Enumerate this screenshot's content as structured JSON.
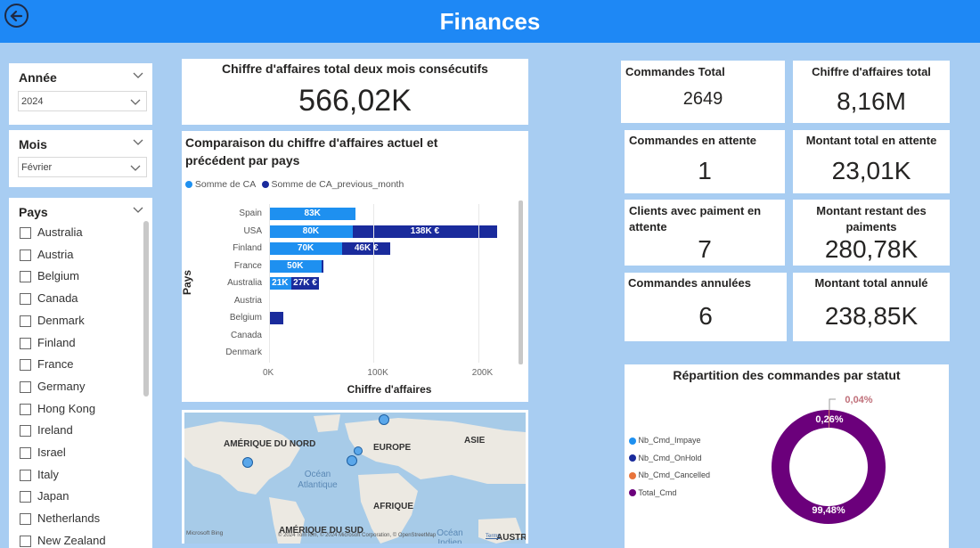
{
  "header": {
    "title": "Finances"
  },
  "filters": {
    "year": {
      "title": "Année",
      "value": "2024"
    },
    "month": {
      "title": "Mois",
      "value": "Février"
    },
    "country": {
      "title": "Pays",
      "items": [
        "Australia",
        "Austria",
        "Belgium",
        "Canada",
        "Denmark",
        "Finland",
        "France",
        "Germany",
        "Hong Kong",
        "Ireland",
        "Israel",
        "Italy",
        "Japan",
        "Netherlands",
        "New Zealand"
      ]
    }
  },
  "kpi_two_month": {
    "label": "Chiffre d'affaires total deux mois consécutifs",
    "value": "566,02K"
  },
  "kpis": {
    "orders_total": {
      "label": "Commandes Total",
      "value": "2649"
    },
    "revenue_total": {
      "label": "Chiffre d'affaires total",
      "value": "8,16M"
    },
    "orders_pending": {
      "label": "Commandes en attente",
      "value": "1"
    },
    "amount_pending": {
      "label": "Montant total en attente",
      "value": "23,01K"
    },
    "clients_pending": {
      "label": "Clients avec paiment en attente",
      "value": "7"
    },
    "amount_remaining": {
      "label": "Montant restant des paiments",
      "value": "280,78K"
    },
    "orders_cancelled": {
      "label": "Commandes annulées",
      "value": "6"
    },
    "amount_cancelled": {
      "label": "Montant total annulé",
      "value": "238,85K"
    }
  },
  "chart_data": [
    {
      "type": "bar",
      "orientation": "horizontal",
      "stacked": true,
      "title": "Comparaison du chiffre d'affaires actuel et précédent par pays",
      "xlabel": "Chiffre d'affaires",
      "ylabel": "Pays",
      "xlim": [
        0,
        230000
      ],
      "xticks": [
        "0K",
        "100K",
        "200K"
      ],
      "legend_position": "top-left",
      "categories": [
        "Spain",
        "USA",
        "Finland",
        "France",
        "Australia",
        "Austria",
        "Belgium",
        "Canada",
        "Denmark"
      ],
      "series": [
        {
          "name": "Somme de CA",
          "color": "#1e90f0",
          "values": [
            83000,
            80000,
            70000,
            50000,
            21000,
            0,
            0,
            0,
            0
          ],
          "labels": [
            "83K",
            "80K",
            "70K",
            "50K",
            "21K",
            "",
            "",
            "",
            ""
          ]
        },
        {
          "name": "Somme de CA_previous_month",
          "color": "#1a2b9c",
          "values": [
            0,
            138000,
            46000,
            2000,
            27000,
            0,
            14000,
            0,
            0
          ],
          "labels": [
            "",
            "138K €",
            "46K €",
            "",
            "27K €",
            "",
            "",
            "",
            ""
          ]
        }
      ]
    },
    {
      "type": "pie",
      "title": "Répartition des commandes par statut",
      "legend_position": "left",
      "series": [
        {
          "name": "Nb_Cmd_Impaye",
          "color": "#1e90f0",
          "value": 0
        },
        {
          "name": "Nb_Cmd_OnHold",
          "color": "#1a2b9c",
          "value": 0.04
        },
        {
          "name": "Nb_Cmd_Cancelled",
          "color": "#e8743b",
          "value": 0.22
        },
        {
          "name": "Total_Cmd",
          "color": "#6b007b",
          "value": 99.48
        }
      ],
      "data_labels": [
        "0,04%",
        "0,26%",
        "99,48%"
      ]
    }
  ],
  "map": {
    "labels": [
      "AMÉRIQUE DU NORD",
      "EUROPE",
      "ASIE",
      "AFRIQUE",
      "AMÉRIQUE DU SUD",
      "AUSTR"
    ],
    "seas": [
      "Océan Atlantique",
      "Océan Indien"
    ],
    "attribution": "© 2024 TomTom, © 2024 Microsoft Corporation, © OpenStreetMap",
    "terms": "Terms",
    "provider": "Microsoft Bing"
  }
}
